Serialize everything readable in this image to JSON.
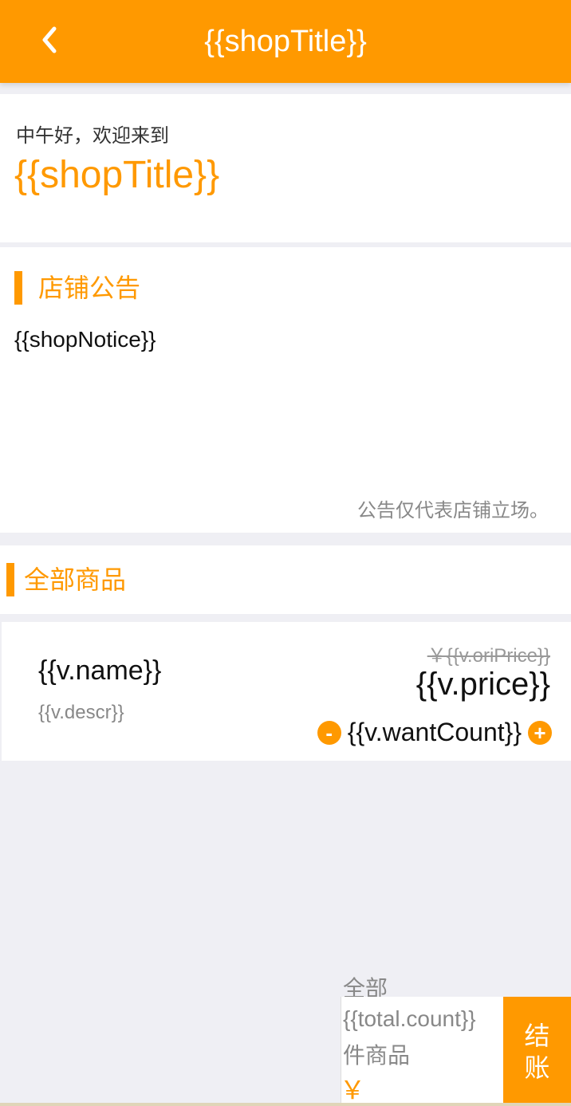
{
  "header": {
    "title": "{{shopTitle}}",
    "back_icon": "chevron-left-icon"
  },
  "welcome": {
    "greeting": "中午好，欢迎来到",
    "shop_name": "{{shopTitle}}"
  },
  "notice": {
    "heading": "店铺公告",
    "body": "{{shopNotice}}",
    "footnote": "公告仅代表店铺立场。"
  },
  "products": {
    "heading": "全部商品",
    "items": [
      {
        "name": "{{v.name}}",
        "descr": "{{v.descr}}",
        "ori_price": "￥{{v.oriPrice}}",
        "price": "{{v.price}}",
        "want_count": "{{v.wantCount}}",
        "minus_label": "-",
        "plus_label": "+"
      }
    ]
  },
  "cart": {
    "label": "全部",
    "count": "{{total.count}}",
    "unit": "件商品",
    "currency": "￥",
    "checkout_line1": "结",
    "checkout_line2": "账"
  },
  "colors": {
    "accent": "#ff9900",
    "background": "#efeff4"
  }
}
